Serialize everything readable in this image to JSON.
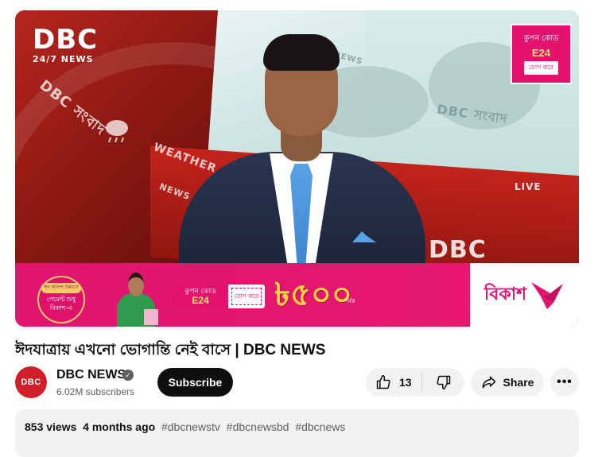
{
  "player": {
    "logo": {
      "main": "DBC",
      "sub": "24/7 NEWS"
    },
    "wall_left": "DBC সংবাদ",
    "wall_weather": "WEATHER",
    "wall_news": "NEWS 3",
    "wall_right_1": "DBC সংবাদ",
    "wall_right_2": "NEWS",
    "wall_live": "LIVE",
    "desk_logo": "DBC",
    "corner_coupon": {
      "label": "কুপন কোড",
      "code": "E24",
      "action": "যোগ করে"
    },
    "ad": {
      "circle_pill": "ঈদ আনন্দ উল্লাসে",
      "circle_line1": "পেমেন্ট শুধু",
      "circle_line2": "বিকাশ-এ",
      "coupon_label": "কুপন কোড",
      "coupon_code": "E24",
      "coupon_action": "যোগ করে",
      "amount": "৳৫০০",
      "amount_sub": "পর্যন্ত",
      "brand": "বিকাশ"
    }
  },
  "video": {
    "title": "ঈদযাত্রায় এখনো ভোগান্তি নেই বাসে | DBC NEWS"
  },
  "channel": {
    "avatar_text": "DBC",
    "name": "DBC NEWS",
    "verified_mark": "✓",
    "subscribers": "6.02M subscribers",
    "subscribe_label": "Subscribe"
  },
  "actions": {
    "like_count": "13",
    "share_label": "Share",
    "more_label": "•••"
  },
  "description": {
    "views": "853 views",
    "when": "4 months ago",
    "tags": [
      "#dbcnewstv",
      "#dbcnewsbd",
      "#dbcnews"
    ]
  },
  "colors": {
    "accent": "#e2126e",
    "subscribe_bg": "#0f0f0f",
    "chip_bg": "#f2f2f2",
    "secondary_text": "#606060"
  }
}
